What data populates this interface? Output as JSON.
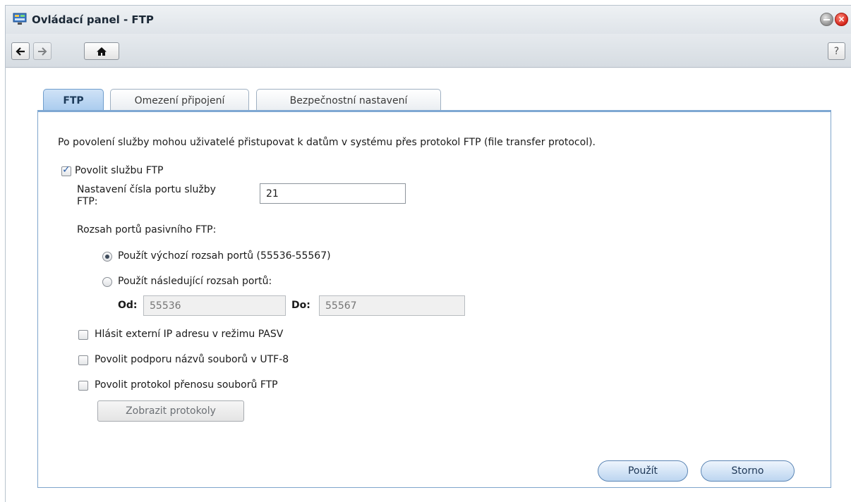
{
  "window": {
    "title": "Ovládací panel - FTP"
  },
  "toolbar": {
    "back_icon": "arrow-left-icon",
    "forward_icon": "arrow-right-icon",
    "home_icon": "home-icon",
    "help_label": "?"
  },
  "tabs": [
    {
      "label": "FTP",
      "active": true
    },
    {
      "label": "Omezení připojení",
      "active": false
    },
    {
      "label": "Bezpečnostní nastavení",
      "active": false
    }
  ],
  "ftp": {
    "description": "Po povolení služby mohou uživatelé přistupovat k datům v systému přes protokol FTP (file transfer protocol).",
    "enable_label": "Povolit službu FTP",
    "enable_checked": true,
    "port_label_line1": "Nastavení čísla portu služby",
    "port_label_line2": "FTP:",
    "port_value": "21",
    "passive_label": "Rozsah portů pasivního FTP:",
    "radio_default_label": "Použít výchozí rozsah portů (55536-55567)",
    "radio_default_checked": true,
    "radio_custom_label": "Použít následující rozsah portů:",
    "radio_custom_checked": false,
    "from_label": "Od:",
    "from_placeholder": "55536",
    "to_label": "Do:",
    "to_placeholder": "55567",
    "pasv_label": "Hlásit externí IP adresu v režimu PASV",
    "pasv_checked": false,
    "utf8_label": "Povolit podporu názvů souborů v UTF-8",
    "utf8_checked": false,
    "log_label": "Povolit protokol přenosu souborů FTP",
    "log_checked": false,
    "show_logs_label": "Zobrazit protokoly"
  },
  "footer": {
    "apply_label": "Použít",
    "cancel_label": "Storno"
  },
  "colors": {
    "accent": "#7fa8d3",
    "tab_active": "#a9cbee",
    "close": "#d4241a"
  }
}
